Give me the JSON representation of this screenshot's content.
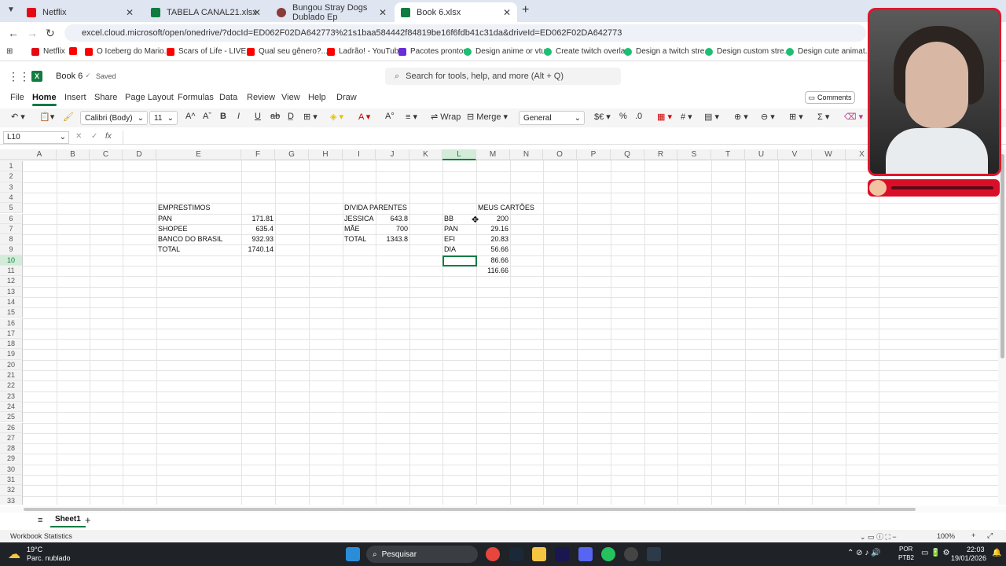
{
  "browser": {
    "tabs": [
      {
        "label": "Netflix",
        "color": "#e50914"
      },
      {
        "label": "TABELA CANAL21.xlsx",
        "color": "#107c41"
      },
      {
        "label": "Bungou Stray Dogs Dublado Ep",
        "color": "#8b3a3a"
      },
      {
        "label": "Book 6.xlsx",
        "color": "#107c41"
      }
    ],
    "url": "excel.cloud.microsoft/open/onedrive/?docId=ED062F02DA642773%21s1baa584442f84819be16f6fdb41c31da&driveId=ED062F02DA642773",
    "bookmarks": [
      {
        "label": "Netflix",
        "color": "#e50914"
      },
      {
        "label": "",
        "color": "#ff0000"
      },
      {
        "label": "O Iceberg do Mario...",
        "color": "#ff0000"
      },
      {
        "label": "Scars of Life - LIVE...",
        "color": "#ff0000"
      },
      {
        "label": "Qual seu gênero?...",
        "color": "#ff0000"
      },
      {
        "label": "Ladrão! - YouTube",
        "color": "#ff0000"
      },
      {
        "label": "Pacotes prontos",
        "color": "#6a2bd9"
      },
      {
        "label": "Design anime or vtu...",
        "color": "#1dbf73"
      },
      {
        "label": "Create twitch overla...",
        "color": "#1dbf73"
      },
      {
        "label": "Design a twitch stre...",
        "color": "#1dbf73"
      },
      {
        "label": "Design custom stre...",
        "color": "#1dbf73"
      },
      {
        "label": "Design cute animat...",
        "color": "#1dbf73"
      }
    ]
  },
  "excel": {
    "title": "Book 6",
    "saved": "Saved",
    "search_placeholder": "Search for tools, help, and more (Alt + Q)",
    "ribbon_tabs": [
      "File",
      "Home",
      "Insert",
      "Share",
      "Page Layout",
      "Formulas",
      "Data",
      "Review",
      "View",
      "Help",
      "Draw"
    ],
    "comments": "Comments",
    "font": "Calibri (Body)",
    "font_size": "11",
    "wrap": "Wrap",
    "merge": "Merge",
    "number_format": "General",
    "name_box": "L10",
    "fx": "fx",
    "columns": [
      "A",
      "B",
      "C",
      "D",
      "E",
      "F",
      "G",
      "H",
      "I",
      "J",
      "K",
      "L",
      "M",
      "N",
      "O",
      "P",
      "Q",
      "R",
      "S",
      "T",
      "U",
      "V",
      "W",
      "X"
    ],
    "rows": [
      "1",
      "2",
      "3",
      "4",
      "5",
      "6",
      "7",
      "8",
      "9",
      "10",
      "11",
      "12",
      "13",
      "14",
      "15",
      "16",
      "17",
      "18",
      "19",
      "20",
      "21",
      "22",
      "23",
      "24",
      "25",
      "26",
      "27",
      "28",
      "29",
      "30",
      "31",
      "32",
      "33"
    ],
    "cells": {
      "E5": "EMPRESTIMOS",
      "E6": "PAN",
      "F6": "171.81",
      "E7": "SHOPEE",
      "F7": "635.4",
      "E8": "BANCO DO BRASIL",
      "F8": "932.93",
      "E9": "TOTAL",
      "F9": "1740.14",
      "I5": "DIVIDA PARENTES",
      "I6": "JESSICA",
      "J6": "643.8",
      "I7": "MÃE",
      "J7": "700",
      "I8": "TOTAL",
      "J8": "1343.8",
      "M5": "MEUS CARTÕES",
      "L6": "BB",
      "M6": "200",
      "L7": "PAN",
      "M7": "29.16",
      "L8": "EFI",
      "M8": "20.83",
      "L9": "DIA",
      "M9": "56.66",
      "M10": "86.66",
      "M11": "116.66"
    },
    "sheet_name": "Sheet1",
    "status": "Workbook Statistics",
    "zoom": "100%"
  },
  "taskbar": {
    "weather_temp": "19°C",
    "weather_desc": "Parc. nublado",
    "search": "Pesquisar",
    "lang1": "POR",
    "lang2": "PTB2",
    "time": "22:03",
    "date": "19/01/2026"
  }
}
